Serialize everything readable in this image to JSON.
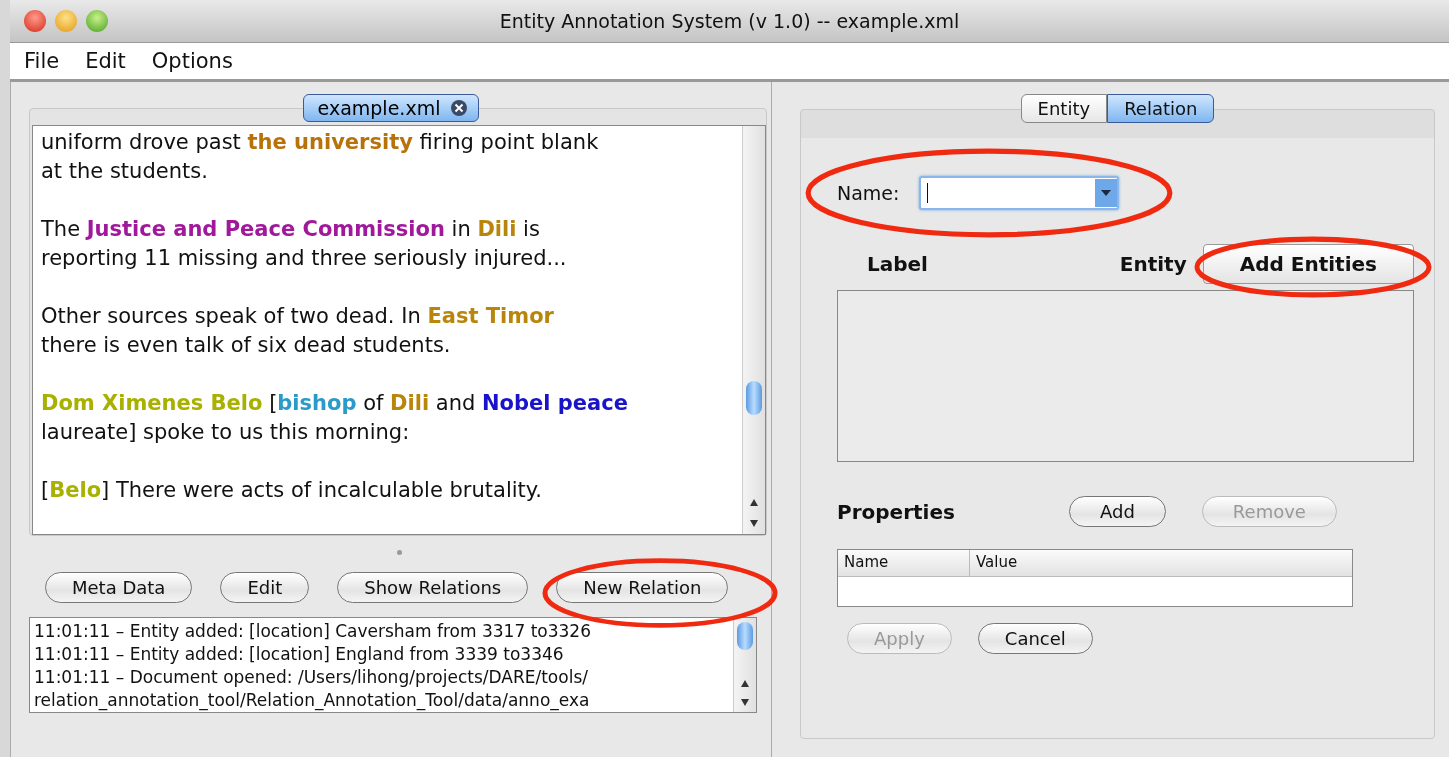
{
  "window": {
    "title": "Entity Annotation System (v 1.0) -- example.xml"
  },
  "menu": [
    "File",
    "Edit",
    "Options"
  ],
  "document_tab": {
    "label": "example.xml"
  },
  "document": {
    "paragraphs": [
      {
        "lines": [
          [
            {
              "text": "uniform drove past "
            },
            {
              "text": "the university",
              "color": "#b8720a"
            },
            {
              "text": " firing point blank"
            }
          ],
          [
            {
              "text": "at the students."
            }
          ]
        ]
      },
      {
        "lines": [
          [
            {
              "text": "The "
            },
            {
              "text": "Justice and Peace Commission",
              "color": "#a0189c"
            },
            {
              "text": " in "
            },
            {
              "text": "Dili",
              "color": "#b8860b"
            },
            {
              "text": " is"
            }
          ],
          [
            {
              "text": "reporting 11 missing and three seriously injured..."
            }
          ]
        ]
      },
      {
        "lines": [
          [
            {
              "text": "Other sources speak of two dead. In "
            },
            {
              "text": "East Timor",
              "color": "#b8860b"
            }
          ],
          [
            {
              "text": "there is even talk of six dead students."
            }
          ]
        ]
      },
      {
        "lines": [
          [
            {
              "text": "Dom Ximenes Belo",
              "color": "#a8b000"
            },
            {
              "text": " ["
            },
            {
              "text": "bishop",
              "color": "#2a9ac8"
            },
            {
              "text": " of "
            },
            {
              "text": "Dili",
              "color": "#b8860b"
            },
            {
              "text": " and "
            },
            {
              "text": "Nobel peace",
              "color": "#1a14c8"
            }
          ],
          [
            {
              "text": "laureate] spoke to us this morning:"
            }
          ]
        ]
      },
      {
        "lines": [
          [
            {
              "text": "["
            },
            {
              "text": "Belo",
              "color": "#a8b000"
            },
            {
              "text": "] There were acts of incalculable brutality."
            }
          ]
        ]
      }
    ]
  },
  "buttons": [
    {
      "label": "Meta Data",
      "circled": false
    },
    {
      "label": "Edit",
      "circled": false
    },
    {
      "label": "Show Relations",
      "circled": false
    },
    {
      "label": "New Relation",
      "circled": true
    }
  ],
  "log": [
    "11:01:11 – Entity added: [location] Caversham from 3317  to3326",
    "11:01:11 – Entity added: [location] England from 3339  to3346",
    "11:01:11 – Document opened: /Users/lihong/projects/DARE/tools/",
    "relation_annotation_tool/Relation_Annotation_Tool/data/anno_exa"
  ],
  "tabs": [
    {
      "label": "Entity",
      "selected": false
    },
    {
      "label": "Relation",
      "selected": true
    }
  ],
  "relation": {
    "name_label": "Name:",
    "name_circled": true,
    "label_header": "Label",
    "entity_header": "Entity",
    "add_entities": {
      "label": "Add Entities",
      "circled": true
    },
    "properties_label": "Properties",
    "property_buttons": [
      {
        "label": "Add",
        "disabled": false
      },
      {
        "label": "Remove",
        "disabled": true
      }
    ],
    "table_columns": [
      "Name",
      "Value"
    ],
    "actions": [
      {
        "label": "Apply",
        "disabled": true
      },
      {
        "label": "Cancel",
        "disabled": false
      }
    ]
  }
}
